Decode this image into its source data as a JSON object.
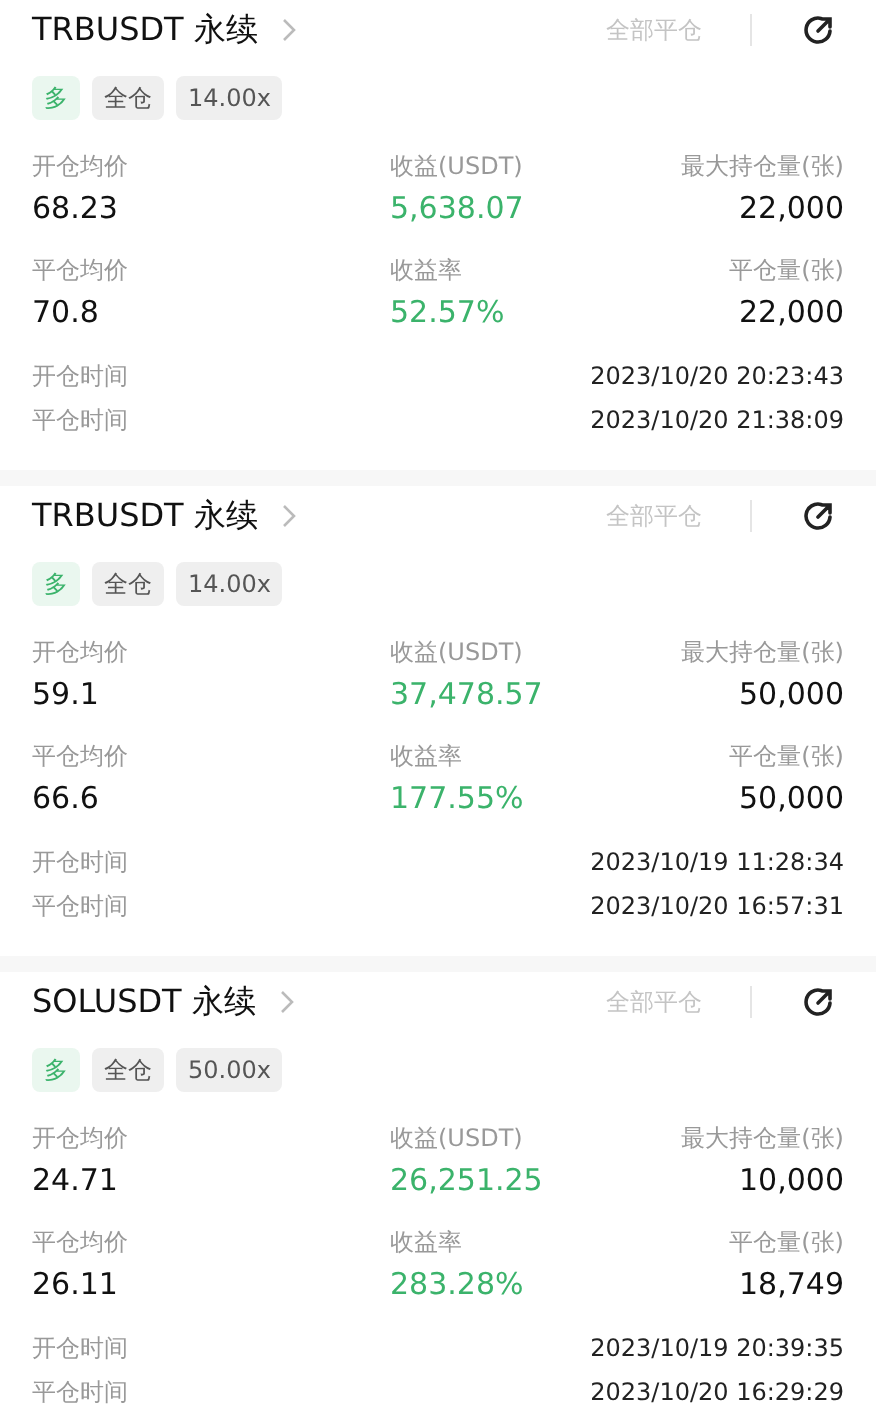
{
  "positions": [
    {
      "symbol": "TRBUSDT 永续",
      "close_all": "全部平仓",
      "tags": [
        {
          "label": "多",
          "kind": "side"
        },
        {
          "label": "全仓",
          "kind": "plain"
        },
        {
          "label": "14.00x",
          "kind": "plain"
        }
      ],
      "stats": [
        {
          "label": "开仓均价",
          "value": "68.23",
          "kind": "plain"
        },
        {
          "label": "收益(USDT)",
          "value": "5,638.07",
          "kind": "profit"
        },
        {
          "label": "最大持仓量(张)",
          "value": "22,000",
          "kind": "plain"
        },
        {
          "label": "平仓均价",
          "value": "70.8",
          "kind": "plain"
        },
        {
          "label": "收益率",
          "value": "52.57%",
          "kind": "profit"
        },
        {
          "label": "平仓量(张)",
          "value": "22,000",
          "kind": "plain"
        }
      ],
      "times": [
        {
          "label": "开仓时间",
          "value": "2023/10/20 20:23:43"
        },
        {
          "label": "平仓时间",
          "value": "2023/10/20 21:38:09"
        }
      ]
    },
    {
      "symbol": "TRBUSDT 永续",
      "close_all": "全部平仓",
      "tags": [
        {
          "label": "多",
          "kind": "side"
        },
        {
          "label": "全仓",
          "kind": "plain"
        },
        {
          "label": "14.00x",
          "kind": "plain"
        }
      ],
      "stats": [
        {
          "label": "开仓均价",
          "value": "59.1",
          "kind": "plain"
        },
        {
          "label": "收益(USDT)",
          "value": "37,478.57",
          "kind": "profit"
        },
        {
          "label": "最大持仓量(张)",
          "value": "50,000",
          "kind": "plain"
        },
        {
          "label": "平仓均价",
          "value": "66.6",
          "kind": "plain"
        },
        {
          "label": "收益率",
          "value": "177.55%",
          "kind": "profit"
        },
        {
          "label": "平仓量(张)",
          "value": "50,000",
          "kind": "plain"
        }
      ],
      "times": [
        {
          "label": "开仓时间",
          "value": "2023/10/19 11:28:34"
        },
        {
          "label": "平仓时间",
          "value": "2023/10/20 16:57:31"
        }
      ]
    },
    {
      "symbol": "SOLUSDT 永续",
      "close_all": "全部平仓",
      "tags": [
        {
          "label": "多",
          "kind": "side"
        },
        {
          "label": "全仓",
          "kind": "plain"
        },
        {
          "label": "50.00x",
          "kind": "plain"
        }
      ],
      "stats": [
        {
          "label": "开仓均价",
          "value": "24.71",
          "kind": "plain"
        },
        {
          "label": "收益(USDT)",
          "value": "26,251.25",
          "kind": "profit"
        },
        {
          "label": "最大持仓量(张)",
          "value": "10,000",
          "kind": "plain"
        },
        {
          "label": "平仓均价",
          "value": "26.11",
          "kind": "plain"
        },
        {
          "label": "收益率",
          "value": "283.28%",
          "kind": "profit"
        },
        {
          "label": "平仓量(张)",
          "value": "18,749",
          "kind": "plain"
        }
      ],
      "times": [
        {
          "label": "开仓时间",
          "value": "2023/10/19 20:39:35"
        },
        {
          "label": "平仓时间",
          "value": "2023/10/20 16:29:29"
        }
      ]
    }
  ]
}
